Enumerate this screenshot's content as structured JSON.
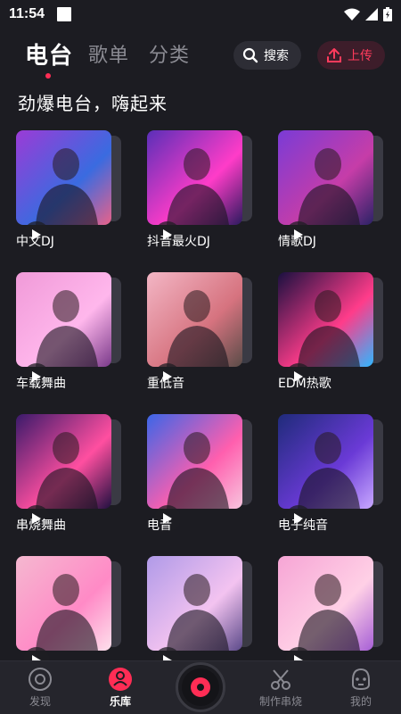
{
  "status_bar": {
    "time": "11:54"
  },
  "top_nav": {
    "tabs": [
      {
        "label": "电台",
        "active": true
      },
      {
        "label": "歌单",
        "active": false
      },
      {
        "label": "分类",
        "active": false
      }
    ],
    "search_label": "搜索",
    "upload_label": "上传"
  },
  "section": {
    "title": "劲爆电台，嗨起来"
  },
  "cards": [
    {
      "label": "中文DJ",
      "icon": "play-icon"
    },
    {
      "label": "抖音最火DJ",
      "icon": "play-icon"
    },
    {
      "label": "情歌DJ",
      "icon": "play-icon"
    },
    {
      "label": "车载舞曲",
      "icon": "play-icon"
    },
    {
      "label": "重低音",
      "icon": "play-icon"
    },
    {
      "label": "EDM热歌",
      "icon": "play-icon"
    },
    {
      "label": "串烧舞曲",
      "icon": "play-icon"
    },
    {
      "label": "电音",
      "icon": "play-icon"
    },
    {
      "label": "电子纯音",
      "icon": "play-icon"
    },
    {
      "label": "",
      "icon": "play-icon"
    },
    {
      "label": "",
      "icon": "play-icon"
    },
    {
      "label": "",
      "icon": "play-icon"
    }
  ],
  "bottom_nav": {
    "items": [
      {
        "label": "发现",
        "icon": "discover-icon",
        "active": false
      },
      {
        "label": "乐库",
        "icon": "library-icon",
        "active": true
      },
      {
        "label": "制作串烧",
        "icon": "mix-icon",
        "active": false
      },
      {
        "label": "我的",
        "icon": "profile-icon",
        "active": false
      }
    ]
  },
  "colors": {
    "accent": "#ff2d55",
    "background": "#1c1c22",
    "nav_background": "#25252c"
  }
}
